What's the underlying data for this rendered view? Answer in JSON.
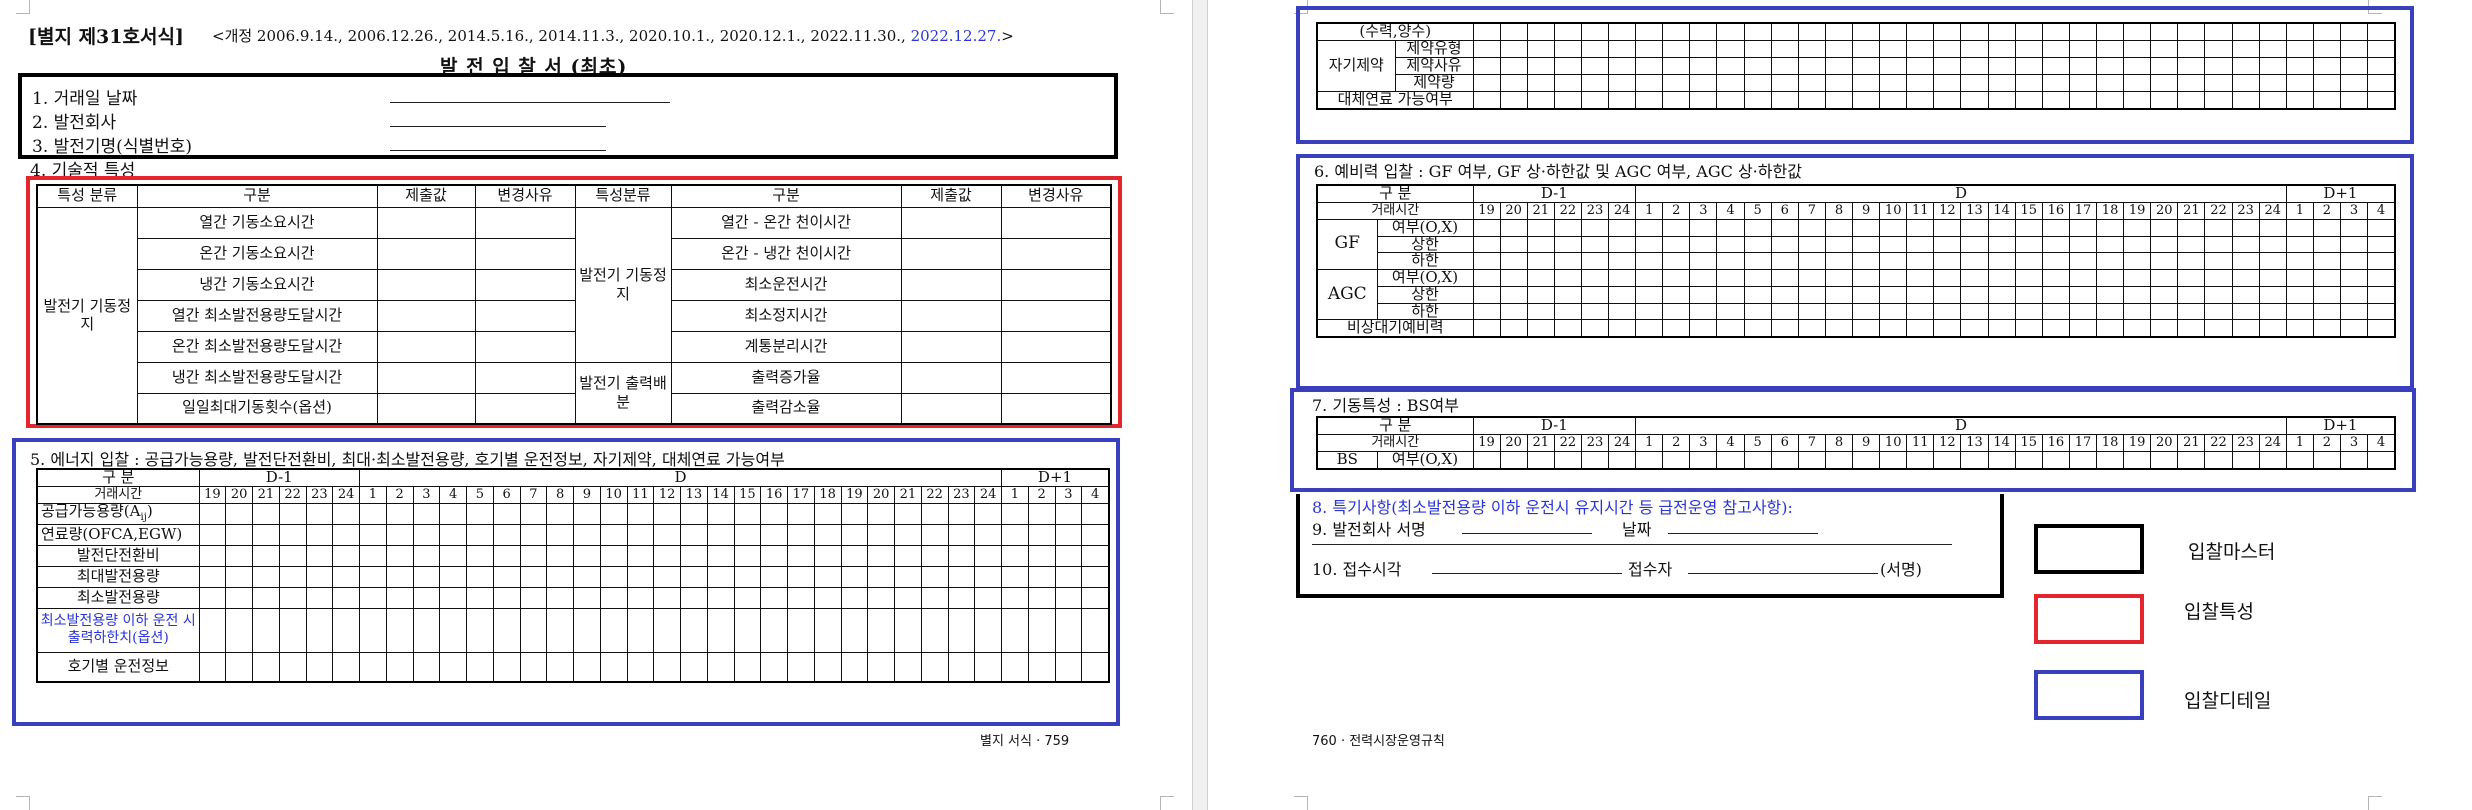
{
  "page1": {
    "form_title": "[별지 제31호서식]",
    "revision": "<개정 2006.9.14., 2006.12.26., 2014.5.16., 2014.11.3., 2020.10.1., 2020.12.1., 2022.11.30.,",
    "revision_latest": "2022.12.27.",
    "revision_close": ">",
    "doc_title": "발 전 입 찰 서 (최초)",
    "master_items": [
      "1. 거래일 날짜",
      "2. 발전회사",
      "3. 발전기명(식별번호)"
    ],
    "section4_title": "4. 기술적 특성",
    "tech_table": {
      "headers": [
        "특성 분류",
        "구분",
        "제출값",
        "변경사유",
        "특성분류",
        "구분",
        "제출값",
        "변경사유"
      ],
      "left_category": "발전기\n기동정지",
      "left_rows": [
        "열간 기동소요시간",
        "온간 기동소요시간",
        "냉간 기동소요시간",
        "열간 최소발전용량도달시간",
        "온간 최소발전용량도달시간",
        "냉간 최소발전용량도달시간",
        "일일최대기동횟수(옵션)"
      ],
      "right_category_1": "발전기\n기동정지",
      "right_rows_1": [
        "열간 - 온간 천이시간",
        "온간 - 냉간 천이시간",
        "최소운전시간",
        "최소정지시간",
        "계통분리시간"
      ],
      "right_category_2": "발전기\n출력배분",
      "right_rows_2": [
        "출력증가율",
        "출력감소율"
      ]
    },
    "section5_title": "5. 에너지 입찰 : 공급가능용량, 발전단전환비, 최대·최소발전용량, 호기별 운전정보, 자기제약, 대체연료 가능여부",
    "energy_table": {
      "header_label": "구 분",
      "day_prev": "D-1",
      "day": "D",
      "day_next": "D+1",
      "hour_label": "거래시간",
      "hours_prev": [
        "19",
        "20",
        "21",
        "22",
        "23",
        "24"
      ],
      "hours_day": [
        "1",
        "2",
        "3",
        "4",
        "5",
        "6",
        "7",
        "8",
        "9",
        "10",
        "11",
        "12",
        "13",
        "14",
        "15",
        "16",
        "17",
        "18",
        "19",
        "20",
        "21",
        "22",
        "23",
        "24"
      ],
      "hours_next": [
        "1",
        "2",
        "3",
        "4"
      ],
      "rows": [
        "공급가능용량(A",
        "연료량(OFCA,EGW)",
        "발전단전환비",
        "최대발전용량",
        "최소발전용량"
      ],
      "supply_sub": "ij",
      "supply_close": ")",
      "blue_row": "최소발전용량 이하 운전\n시 출력하한치(옵션)",
      "last_row": "호기별 운전정보"
    },
    "footer": "별지 서식 · 759"
  },
  "page2": {
    "self_constraint_table": {
      "top_row": "(수력,양수)",
      "group_label": "자기제약",
      "sub_rows": [
        "제약유형",
        "제약사유",
        "제약량"
      ],
      "last_row": "대체연료 가능여부"
    },
    "section6_title": "6. 예비력 입찰 : GF 여부, GF 상·하한값 및 AGC 여부, AGC 상·하한값",
    "reserve_table": {
      "header_label": "구 분",
      "hour_label": "거래시간",
      "gf_label": "GF",
      "agc_label": "AGC",
      "sub_rows": [
        "여부(O,X)",
        "상한",
        "하한"
      ],
      "last_row": "비상대기예비력"
    },
    "section7_title": "7. 기동특성 : BS여부",
    "bs_table": {
      "header_label": "구 분",
      "hour_label": "거래시간",
      "bs_label": "BS",
      "bs_sub": "여부(O,X)"
    },
    "section8": "8. 특기사항(최소발전용량 이하 운전시 유지시간 등 급전운영 참고사항):",
    "section9_label": "9. 발전회사 서명",
    "section9_date": "날짜",
    "section10_label": "10. 접수시각",
    "section10_receiver": "접수자",
    "section10_sign": "(서명)",
    "footer": "760 · 전력시장운영규칙"
  },
  "legend": {
    "items": [
      {
        "label": "입찰마스터",
        "color": "#000000"
      },
      {
        "label": "입찰특성",
        "color": "#e4262c"
      },
      {
        "label": "입찰디테일",
        "color": "#3a3fbd"
      }
    ]
  }
}
